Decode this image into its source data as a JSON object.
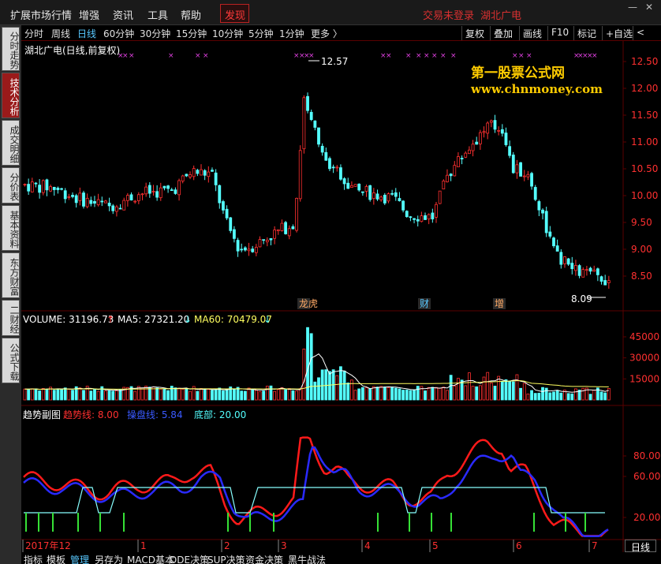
{
  "menu": {
    "items": [
      "扩展市场行情",
      "增强",
      "资讯",
      "工具",
      "帮助"
    ],
    "active": "发现",
    "login": "交易未登录",
    "stock_name_top": "湖北广电"
  },
  "sidebar_tabs": [
    {
      "label": "分时走势",
      "active": false
    },
    {
      "label": "技术分析",
      "active": true
    },
    {
      "label": "成交明细",
      "active": false
    },
    {
      "label": "分价表",
      "active": false
    },
    {
      "label": "基本资料",
      "active": false
    },
    {
      "label": "东方财富",
      "active": false
    },
    {
      "label": "二财经",
      "active": false
    },
    {
      "label": "公式下载",
      "active": false
    }
  ],
  "periods": [
    "分时",
    "周线",
    "日线",
    "60分钟",
    "30分钟",
    "15分钟",
    "10分钟",
    "5分钟",
    "1分钟",
    "更多 〉"
  ],
  "active_period": "日线",
  "toolbar_buttons": [
    "复权",
    "叠加",
    "画线",
    "F10",
    "标记",
    "+自选",
    "<"
  ],
  "chart": {
    "title": "湖北广电(日线,前复权)",
    "price_axis": [
      "12.50",
      "12.00",
      "11.50",
      "11.00",
      "10.50",
      "10.00",
      "9.50",
      "9.00",
      "8.50"
    ],
    "high_label": "12.57",
    "low_label": "8.09",
    "event_tags": [
      "龙虎",
      "财",
      "增"
    ],
    "watermark_line1": "第一股票公式网",
    "watermark_line2": "www.chnmoney.com"
  },
  "volume": {
    "label_volume": "VOLUME: 31196.73",
    "label_ma5": "MA5: 27321.20",
    "label_ma60": "MA60: 70479.07",
    "axis": [
      "45000",
      "30000",
      "15000"
    ],
    "arrow_up": "↑",
    "arrow_down": "↓"
  },
  "sub_indicator": {
    "name": "趋势副图",
    "trend": "趋势线: 8.00",
    "control": "操盘线: 5.84",
    "bottom": "底部: 20.00",
    "axis": [
      "80.00",
      "60.00",
      "20.00"
    ]
  },
  "date_axis": [
    "2017年12",
    "1",
    "2",
    "3",
    "4",
    "5",
    "6",
    "7"
  ],
  "bottom_tabs": [
    "指标",
    "模板",
    "管理",
    "另存为",
    "MACD基本",
    "DDE决策",
    "SUP决策",
    "资金决策",
    "黑牛战法"
  ],
  "bottom_active": "管理",
  "period_indicator": "日线",
  "colors": {
    "up": "#ff3030",
    "down": "#54ffff",
    "accent": "#58c8ff",
    "brand": "#ffcc00",
    "grid": "#5a0000",
    "trend_line": "#ff1a1a",
    "control_line": "#2a2aff"
  }
}
